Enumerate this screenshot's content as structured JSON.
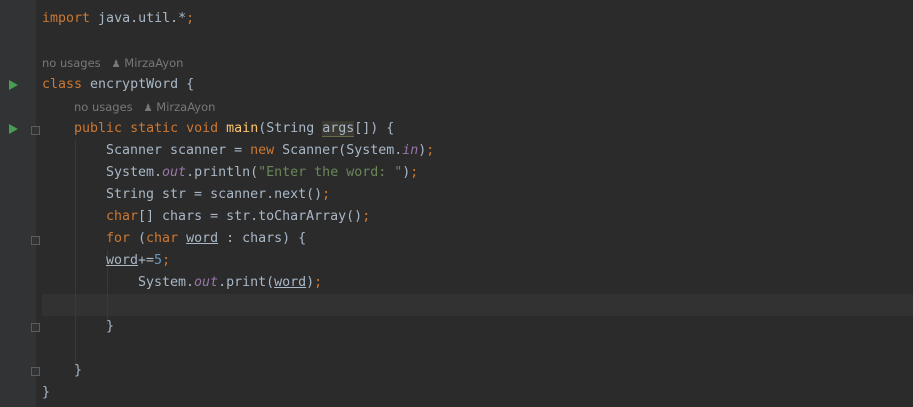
{
  "code": {
    "line1": {
      "kw": "import",
      "rest": " java.util.*",
      "semi": ";"
    },
    "line_class": {
      "kw": "class",
      "rest": " encryptWord {"
    },
    "line_main": {
      "kw1": "public",
      "kw2": "static",
      "kw3": "void",
      "fn": "main",
      "p1": "(String ",
      "param": "args",
      "p2": "[]) {"
    },
    "line_scanner": {
      "a": "Scanner scanner = ",
      "kw": "new",
      "b": " Scanner(System.",
      "static": "in",
      "c": ")",
      "semi": ";"
    },
    "line_println": {
      "a": "System.",
      "static": "out",
      "b": ".println(",
      "str": "\"Enter the word: \"",
      "c": ")",
      "semi": ";"
    },
    "line_str": {
      "a": "String str = scanner.next()",
      "semi": ";"
    },
    "line_chars": {
      "kw": "char",
      "a": "[] chars = str.toCharArray()",
      "semi": ";"
    },
    "line_for": {
      "kw1": "for",
      "a": " (",
      "kw2": "char",
      "b": " ",
      "var": "word",
      "c": " : chars) {"
    },
    "line_inc": {
      "var": "word",
      "op": "+=",
      "num": "5",
      "semi": ";"
    },
    "line_print": {
      "a": "System.",
      "static": "out",
      "b": ".print(",
      "var": "word",
      "c": ")",
      "semi": ";"
    },
    "line_close_for": "}",
    "line_close_main": "}",
    "line_close_class": "}"
  },
  "hints": {
    "class_usages": "no usages",
    "class_author": "MirzaAyon",
    "main_usages": "no usages",
    "main_author": "MirzaAyon"
  },
  "icons": {
    "run": "run-triangle-icon",
    "fold": "fold-marker-icon",
    "user": "user-icon"
  },
  "colors": {
    "background": "#2b2b2b",
    "keyword": "#cc7832",
    "string": "#6a8759",
    "number": "#6897bb",
    "static_field": "#9876aa",
    "method": "#ffc66d",
    "run_icon": "#499c54"
  }
}
